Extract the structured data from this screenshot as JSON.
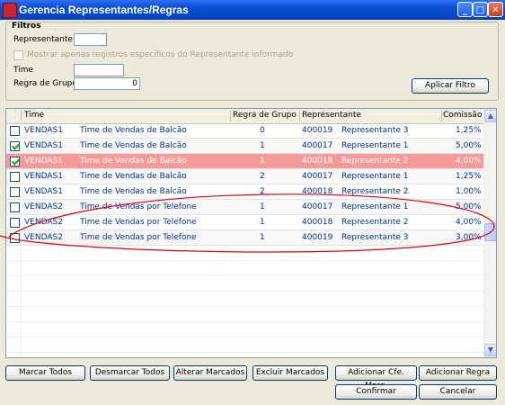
{
  "window": {
    "title": "Gerencia Representantes/Regras",
    "minimize": "_",
    "maximize": "□",
    "close": "✕"
  },
  "filters": {
    "group_title": "Filtros",
    "representante_label": "Representante",
    "representante_value": "",
    "only_rep_label": "Mostrar apenas registros específicos do Representante informado",
    "time_label": "Time",
    "time_value": "",
    "regra_label": "Regra de Grupo",
    "regra_value": "0",
    "apply_button": "Aplicar Filtro"
  },
  "grid": {
    "columns": [
      "Time",
      "Regra de Grupo",
      "Representante",
      "Comissão"
    ],
    "rows": [
      {
        "checked": false,
        "code": "VENDAS1",
        "name": "Time de Vendas de Balcão",
        "regra": "0",
        "rep_code": "400019",
        "rep_name": "Representante 3",
        "comissao": "1,25%"
      },
      {
        "checked": true,
        "code": "VENDAS1",
        "name": "Time de Vendas de Balcão",
        "regra": "1",
        "rep_code": "400017",
        "rep_name": "Representante 1",
        "comissao": "5,00%"
      },
      {
        "checked": true,
        "code": "VENDAS1",
        "name": "Time de Vendas de Balcão",
        "regra": "1",
        "rep_code": "400018",
        "rep_name": "Representante 2",
        "comissao": "4,00%"
      },
      {
        "checked": false,
        "code": "VENDAS1",
        "name": "Time de Vendas de Balcão",
        "regra": "2",
        "rep_code": "400017",
        "rep_name": "Representante 1",
        "comissao": "1,25%"
      },
      {
        "checked": false,
        "code": "VENDAS1",
        "name": "Time de Vendas de Balcão",
        "regra": "2",
        "rep_code": "400018",
        "rep_name": "Representante 2",
        "comissao": "1,00%"
      },
      {
        "checked": false,
        "code": "VENDAS2",
        "name": "Time de Vendas por Telefone",
        "regra": "1",
        "rep_code": "400017",
        "rep_name": "Representante 1",
        "comissao": "5,00%"
      },
      {
        "checked": false,
        "code": "VENDAS2",
        "name": "Time de Vendas por Telefone",
        "regra": "1",
        "rep_code": "400018",
        "rep_name": "Representante 2",
        "comissao": "4,00%"
      },
      {
        "checked": false,
        "code": "VENDAS2",
        "name": "Time de Vendas por Telefone",
        "regra": "1",
        "rep_code": "400019",
        "rep_name": "Representante 3",
        "comissao": "3,00%"
      }
    ],
    "scroll_up": "▲",
    "scroll_down": "▼"
  },
  "buttons": {
    "marcar_todos": "Marcar Todos",
    "desmarcar_todos": "Desmarcar Todos",
    "alterar_marcados": "Alterar Marcados",
    "excluir_marcados": "Excluir Marcados",
    "adicionar_cfe": "Adicionar Cfe. Marc.",
    "adicionar_regra": "Adicionar Regra",
    "confirmar": "Confirmar",
    "cancelar": "Cancelar"
  },
  "colors": {
    "selected_row": "#f59a98",
    "annotation": "#e8000f"
  }
}
